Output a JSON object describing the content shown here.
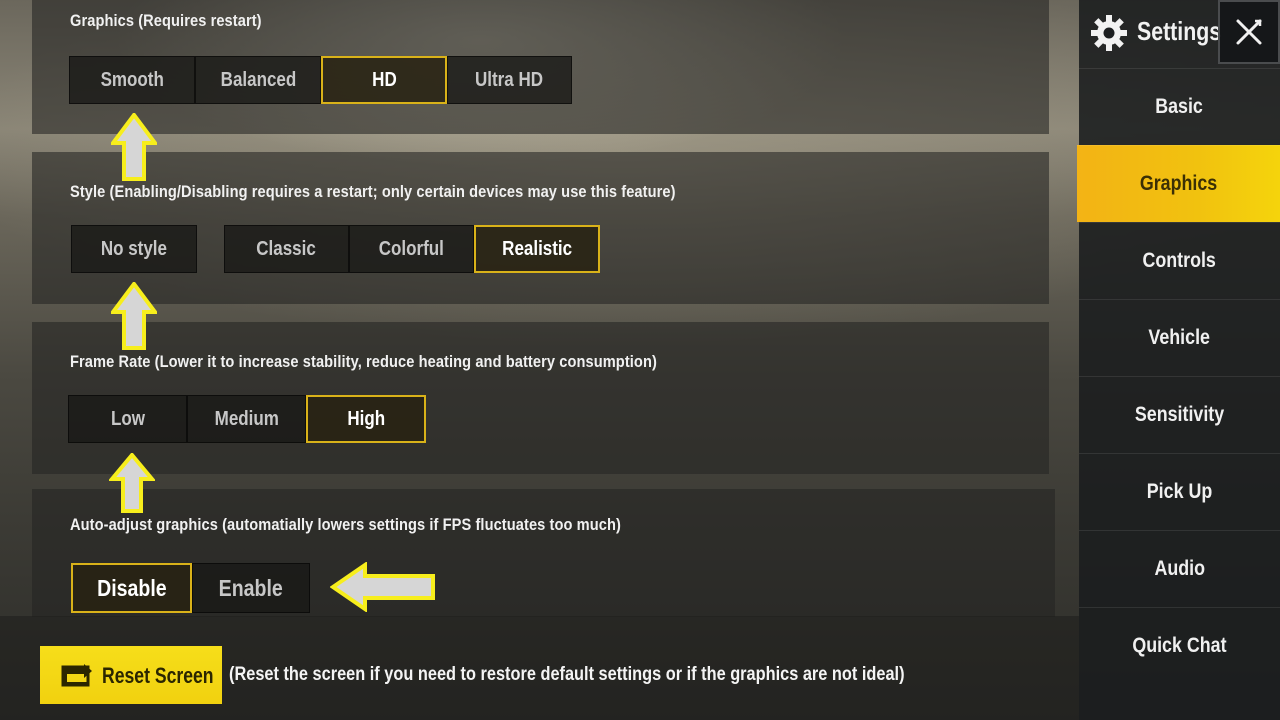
{
  "sidebar": {
    "title": "Settings",
    "items": [
      {
        "label": "Basic",
        "active": false
      },
      {
        "label": "Graphics",
        "active": true
      },
      {
        "label": "Controls",
        "active": false
      },
      {
        "label": "Vehicle",
        "active": false
      },
      {
        "label": "Sensitivity",
        "active": false
      },
      {
        "label": "Pick Up",
        "active": false
      },
      {
        "label": "Audio",
        "active": false
      },
      {
        "label": "Quick Chat",
        "active": false
      }
    ]
  },
  "sections": {
    "graphics": {
      "label": "Graphics (Requires restart)",
      "options": [
        "Smooth",
        "Balanced",
        "HD",
        "Ultra HD"
      ],
      "selected": "HD"
    },
    "style": {
      "label": "Style (Enabling/Disabling requires a restart; only certain devices may use this feature)",
      "options": [
        "No style",
        "Classic",
        "Colorful",
        "Realistic"
      ],
      "selected": "Realistic"
    },
    "frame_rate": {
      "label": "Frame Rate (Lower it to increase stability, reduce heating and battery consumption)",
      "options": [
        "Low",
        "Medium",
        "High"
      ],
      "selected": "High"
    },
    "auto_adjust": {
      "label": "Auto-adjust graphics (automatially lowers settings if FPS fluctuates too much)",
      "options": [
        "Disable",
        "Enable"
      ],
      "selected": "Disable"
    }
  },
  "reset": {
    "label": "Reset Screen",
    "note": "(Reset the screen if you need to restore default settings or if the graphics are not ideal)"
  },
  "colors": {
    "accent": "#f1c20f",
    "selected_border": "#d9b219",
    "annotation_arrow": "#f7ee1c"
  },
  "icons": {
    "settings": "gear-icon",
    "close": "close-icon",
    "reset": "reset-screen-icon",
    "annotation": "annotation-arrow-icon"
  }
}
